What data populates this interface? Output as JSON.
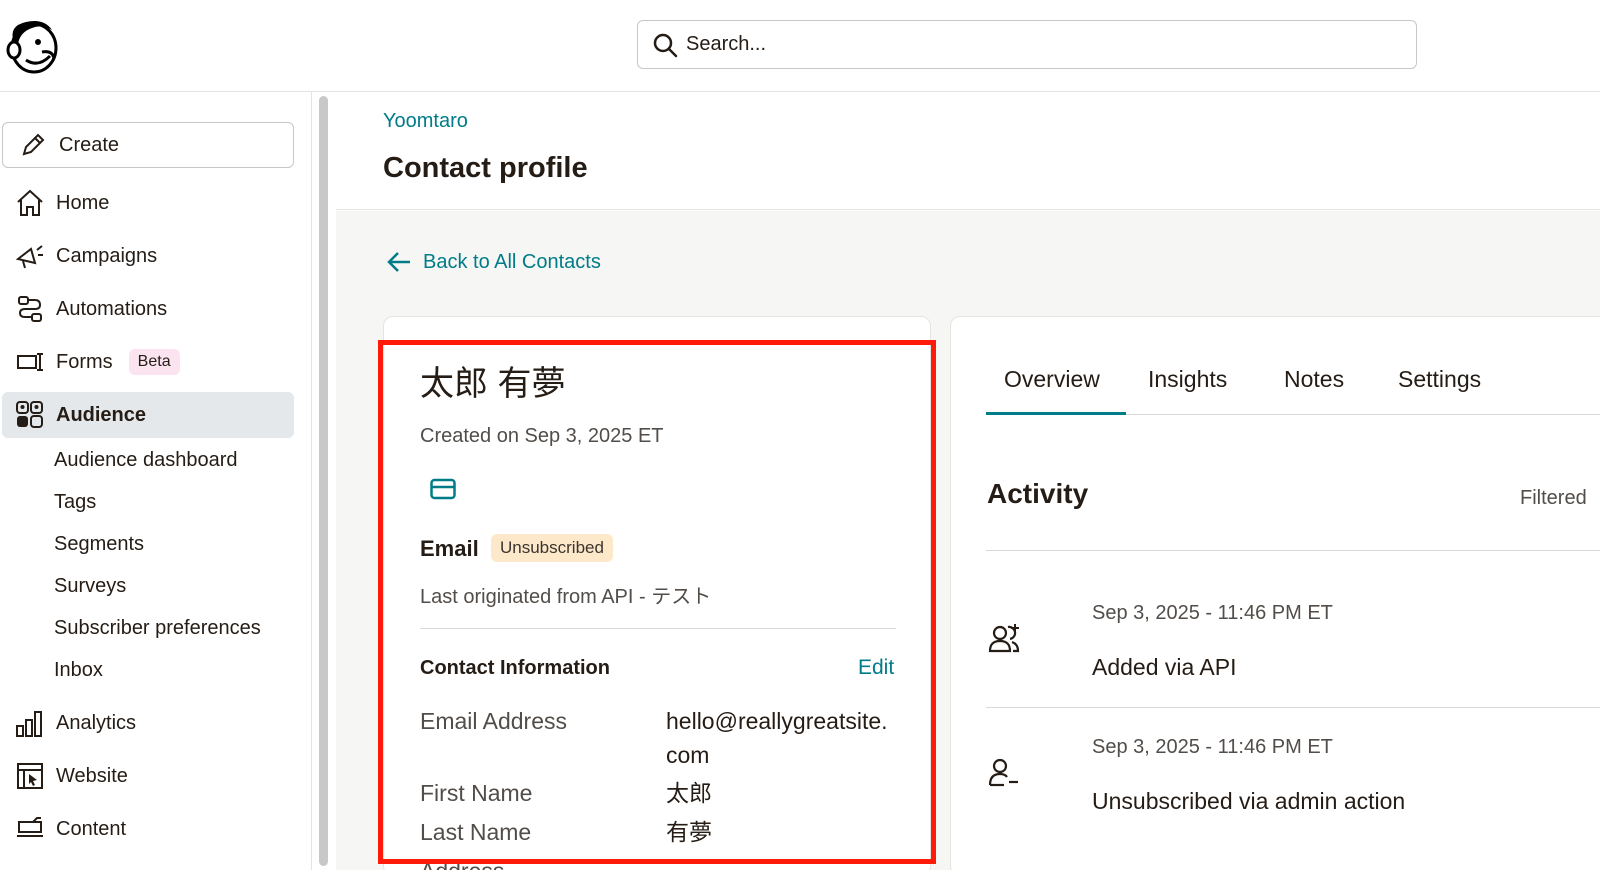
{
  "search": {
    "placeholder": "Search..."
  },
  "sidebar": {
    "create_label": "Create",
    "items": [
      {
        "label": "Home"
      },
      {
        "label": "Campaigns"
      },
      {
        "label": "Automations"
      },
      {
        "label": "Forms",
        "badge": "Beta"
      },
      {
        "label": "Audience"
      },
      {
        "label": "Analytics"
      },
      {
        "label": "Website"
      },
      {
        "label": "Content"
      }
    ],
    "audience_sub": [
      "Audience dashboard",
      "Tags",
      "Segments",
      "Surveys",
      "Subscriber preferences",
      "Inbox"
    ]
  },
  "header": {
    "breadcrumb": "Yoomtaro",
    "title": "Contact profile"
  },
  "back_link": "Back to All Contacts",
  "profile": {
    "name": "太郎 有夢",
    "created_on": "Created on Sep 3, 2025 ET",
    "email_label": "Email",
    "email_status": "Unsubscribed",
    "originated": "Last originated from API - テスト",
    "contact_info_title": "Contact Information",
    "edit_label": "Edit",
    "fields": [
      {
        "label": "Email Address",
        "value": "hello@reallygreatsite.com"
      },
      {
        "label": "First Name",
        "value": "太郎"
      },
      {
        "label": "Last Name",
        "value": "有夢"
      },
      {
        "label": "Address",
        "value": ""
      }
    ]
  },
  "tabs": [
    "Overview",
    "Insights",
    "Notes",
    "Settings"
  ],
  "activity": {
    "title": "Activity",
    "filter_label": "Filtered",
    "events": [
      {
        "time": "Sep 3, 2025 - 11:46 PM ET",
        "description": "Added via API",
        "icon": "user-add-icon"
      },
      {
        "time": "Sep 3, 2025 - 11:46 PM ET",
        "description": "Unsubscribed via admin action",
        "icon": "user-remove-icon"
      }
    ]
  },
  "colors": {
    "accent": "#007c89",
    "highlight": "#ff1a0a",
    "active_nav_bg": "#e4e8ea",
    "beta_bg": "#fbe4ef",
    "unsubscribed_bg": "#fde9c9"
  }
}
